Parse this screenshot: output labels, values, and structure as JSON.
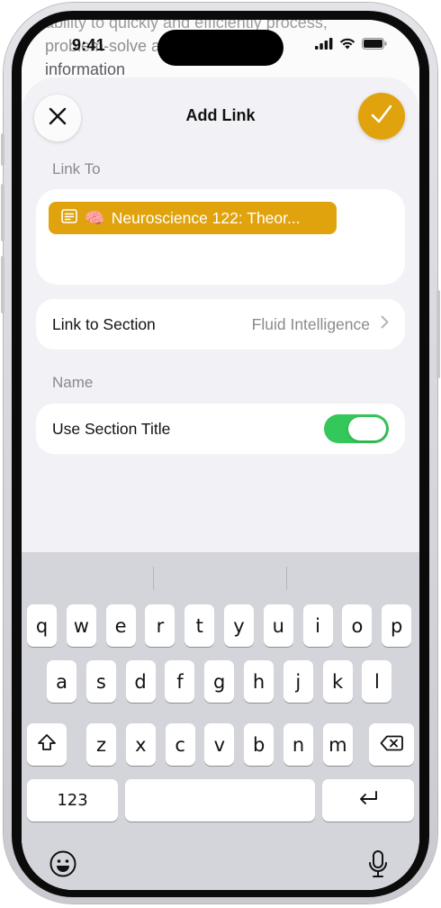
{
  "status_bar": {
    "time": "9:41"
  },
  "background_doc": {
    "lines": [
      "ability to quickly and efficiently process,",
      "problem-solve    abstract",
      "information"
    ]
  },
  "sheet": {
    "title": "Add Link",
    "close_icon": "xmark-icon",
    "done_icon": "checkmark-icon",
    "accent_color": "#e0a30e"
  },
  "link_to": {
    "label": "Link To",
    "chip": {
      "icon": "note-icon",
      "emoji": "🧠",
      "text": "Neuroscience 122: Theor..."
    }
  },
  "link_to_section": {
    "label": "Link to Section",
    "value": "Fluid Intelligence",
    "icon": "chevron-right-icon"
  },
  "name": {
    "label": "Name",
    "use_section_title": {
      "label": "Use Section Title",
      "on": true,
      "color": "#34c759"
    }
  },
  "keyboard": {
    "row1": [
      "q",
      "w",
      "e",
      "r",
      "t",
      "y",
      "u",
      "i",
      "o",
      "p"
    ],
    "row2": [
      "a",
      "s",
      "d",
      "f",
      "g",
      "h",
      "j",
      "k",
      "l"
    ],
    "row3": [
      "z",
      "x",
      "c",
      "v",
      "b",
      "n",
      "m"
    ],
    "numbers_label": "123",
    "space_label": "",
    "shift_icon": "shift-icon",
    "delete_icon": "delete-backward-icon",
    "return_icon": "return-icon",
    "emoji_icon": "emoji-icon",
    "mic_icon": "microphone-icon"
  }
}
